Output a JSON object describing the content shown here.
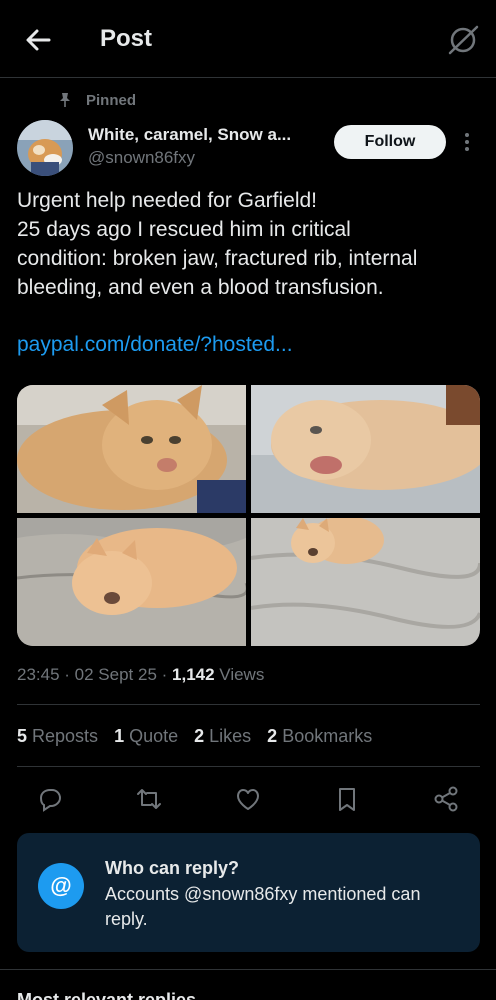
{
  "header": {
    "title": "Post",
    "back_icon": "arrow-left-icon",
    "grok_icon": "grok-icon"
  },
  "post": {
    "pinned_label": "Pinned",
    "author": {
      "name": "White, caramel, Snow a...",
      "handle": "@snown86fxy"
    },
    "follow_label": "Follow",
    "text_lines": [
      "Urgent help needed for Garfield!",
      "25 days ago I rescued him in critical",
      "condition: broken jaw, fractured rib, internal",
      "bleeding, and even a blood transfusion."
    ],
    "link": "paypal.com/donate/?hosted...",
    "meta": {
      "time": "23:45",
      "date": "02 Sept 25",
      "views_count": "1,142",
      "views_label": "Views"
    },
    "stats": [
      {
        "count": "5",
        "label": "Reposts"
      },
      {
        "count": "1",
        "label": "Quote"
      },
      {
        "count": "2",
        "label": "Likes"
      },
      {
        "count": "2",
        "label": "Bookmarks"
      }
    ],
    "actions": [
      "reply-icon",
      "repost-icon",
      "like-icon",
      "bookmark-icon",
      "share-icon"
    ]
  },
  "reply_restriction": {
    "title": "Who can reply?",
    "body": "Accounts @snown86fxy mentioned can reply.",
    "icon_glyph": "@"
  },
  "footer": {
    "section_label": "Most relevant replies"
  },
  "colors": {
    "background": "#000000",
    "text_primary": "#e7e9ea",
    "text_secondary": "#71767b",
    "accent": "#1d9bf0",
    "reply_box_bg": "#0c2133"
  }
}
